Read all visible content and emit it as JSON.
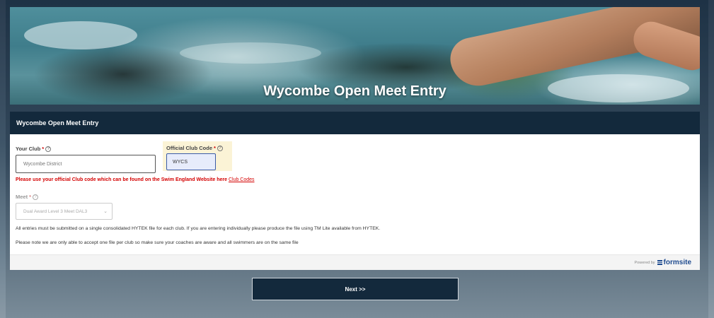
{
  "banner": {
    "title": "Wycombe Open Meet Entry"
  },
  "form": {
    "header": "Wycombe Open Meet Entry",
    "club": {
      "label": "Your Club",
      "required_mark": "*",
      "help": "?",
      "value": "Wycombe District"
    },
    "club_code": {
      "label": "Official Club Code",
      "required_mark": "*",
      "help": "?",
      "value": "WYCS"
    },
    "notice": {
      "text": "Please use your official Club code which can be found on the Swim England Website here",
      "link": "Club Codes"
    },
    "meet": {
      "label": "Meet",
      "required_mark": "*",
      "help": "?",
      "value": "Dual Award Level 3 Meet DAL3"
    },
    "paragraph1": "All entries must be submitted on a single consolidated HYTEK file for each club. If you are entering individually please produce the file using TM Lite available from HYTEK.",
    "paragraph2": "Please note we are only able to accept one file per club so make sure your coaches are aware and all swimmers are on the same file",
    "footer": {
      "powered_by": "Powered by",
      "brand": "formsite"
    }
  },
  "actions": {
    "next_label": "Next >>"
  },
  "colors": {
    "header_bg": "#13293c",
    "notice_red": "#d40000",
    "brand_blue": "#1f4b8f",
    "code_highlight": "#fbf3d6"
  }
}
